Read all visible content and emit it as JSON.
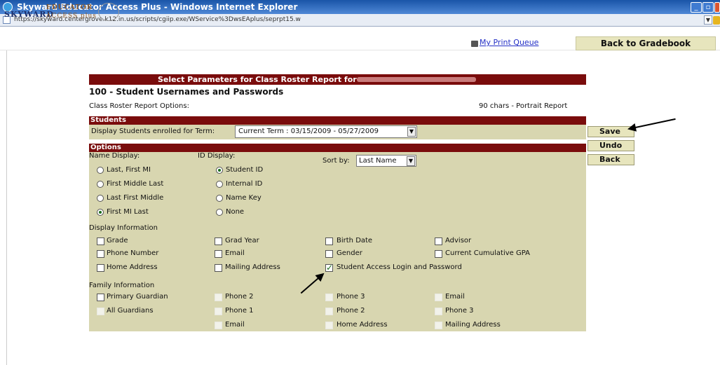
{
  "window": {
    "title": "Skyward Educator Access Plus - Windows Internet Explorer",
    "url": "https://skyward.centergrove.k12.in.us/scripts/cgiip.exe/WService%3DwsEAplus/seprpt15.w",
    "min": "_",
    "max": "▫",
    "close": "×"
  },
  "logo": {
    "sky": "SKYWARD",
    "edu": "EDUCATOR",
    "acc": "ACCESS plus"
  },
  "header": {
    "print_queue": "My Print Queue",
    "back": "Back to Gradebook"
  },
  "report": {
    "banner": "Select Parameters for Class Roster Report for",
    "title": "100 -  Student Usernames and Passwords",
    "options_label": "Class Roster Report Options:",
    "format": "90 chars - Portrait Report"
  },
  "students": {
    "heading": "Students",
    "term_label": "Display Students enrolled for Term:",
    "term_value": "Current Term : 03/15/2009 - 05/27/2009"
  },
  "buttons": {
    "save": "Save",
    "undo": "Undo",
    "back": "Back"
  },
  "options": {
    "heading": "Options",
    "name_display": "Name Display:",
    "id_display": "ID Display:",
    "sort_label": "Sort by:",
    "sort_value": "Last Name",
    "names": [
      "Last, First MI",
      "First Middle Last",
      "Last First Middle",
      "First MI Last"
    ],
    "ids": [
      "Student ID",
      "Internal ID",
      "Name Key",
      "None"
    ]
  },
  "display_info": {
    "heading": "Display Information",
    "col1": [
      "Grade",
      "Phone Number",
      "Home Address"
    ],
    "col2": [
      "Grad Year",
      "Email",
      "Mailing Address"
    ],
    "col3": [
      "Birth Date",
      "Gender",
      "Student Access Login and Password"
    ],
    "col4": [
      "Advisor",
      "Current Cumulative GPA"
    ]
  },
  "family_info": {
    "heading": "Family Information",
    "row1": [
      "Primary Guardian",
      "Phone 2",
      "Phone 3",
      "Email"
    ],
    "row2": [
      "All Guardians",
      "Phone 1",
      "Phone 2",
      "Phone 3"
    ],
    "row3": [
      "Email",
      "Home Address",
      "Mailing Address"
    ]
  },
  "colors": {
    "maroon": "#7a0c0c",
    "panel": "#d8d6b0",
    "button": "#e7e5bd",
    "link": "#2430c6"
  }
}
